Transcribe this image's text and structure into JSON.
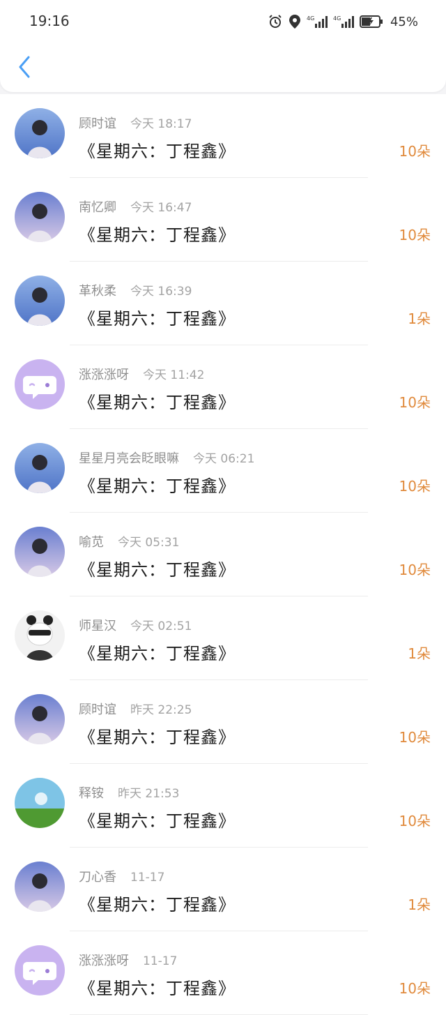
{
  "status_bar": {
    "time": "19:16",
    "battery_percent": "45%",
    "icons": [
      "alarm-icon",
      "location-icon",
      "signal-4g-icon",
      "signal-4g-icon",
      "battery-charging-icon"
    ]
  },
  "header": {
    "back_icon": "chevron-left-icon"
  },
  "colors": {
    "accent_blue": "#4a9ff5",
    "count_orange": "#e08a3c",
    "default_avatar_purple": "#c9b3f0"
  },
  "list": [
    {
      "name": "顾时谊",
      "time": "今天 18:17",
      "title": "《星期六：丁程鑫》",
      "count": "10朵",
      "avatar": "photo-avatar"
    },
    {
      "name": "南忆卿",
      "time": "今天 16:47",
      "title": "《星期六：丁程鑫》",
      "count": "10朵",
      "avatar": "photo-avatar"
    },
    {
      "name": "革秋柔",
      "time": "今天 16:39",
      "title": "《星期六：丁程鑫》",
      "count": "1朵",
      "avatar": "photo-avatar"
    },
    {
      "name": "涨涨涨呀",
      "time": "今天 11:42",
      "title": "《星期六：丁程鑫》",
      "count": "10朵",
      "avatar": "default-chat-avatar"
    },
    {
      "name": "星星月亮会眨眼嘛",
      "time": "今天 06:21",
      "title": "《星期六：丁程鑫》",
      "count": "10朵",
      "avatar": "photo-avatar"
    },
    {
      "name": "喻苋",
      "time": "今天 05:31",
      "title": "《星期六：丁程鑫》",
      "count": "10朵",
      "avatar": "photo-avatar"
    },
    {
      "name": "师星汉",
      "time": "今天 02:51",
      "title": "《星期六：丁程鑫》",
      "count": "1朵",
      "avatar": "panda-avatar"
    },
    {
      "name": "顾时谊",
      "time": "昨天 22:25",
      "title": "《星期六：丁程鑫》",
      "count": "10朵",
      "avatar": "photo-avatar"
    },
    {
      "name": "释铵",
      "time": "昨天 21:53",
      "title": "《星期六：丁程鑫》",
      "count": "10朵",
      "avatar": "landscape-avatar"
    },
    {
      "name": "刀心香",
      "time": "11-17",
      "title": "《星期六：丁程鑫》",
      "count": "1朵",
      "avatar": "photo-avatar"
    },
    {
      "name": "涨涨涨呀",
      "time": "11-17",
      "title": "《星期六：丁程鑫》",
      "count": "10朵",
      "avatar": "default-chat-avatar"
    }
  ]
}
